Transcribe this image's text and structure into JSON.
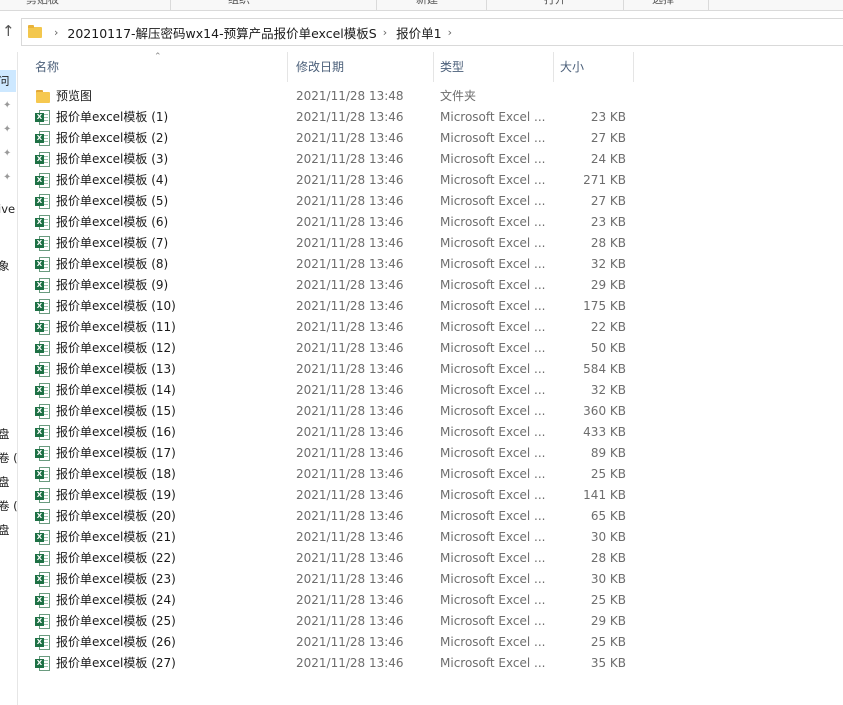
{
  "ribbon": {
    "groups": [
      "剪贴板",
      "组织",
      "新建",
      "打开",
      "选择"
    ]
  },
  "address": {
    "crumbs": [
      "20210117-解压密码wx14-预算产品报价单excel模板S",
      "报价单1"
    ]
  },
  "nav_pane": {
    "items": [
      "问",
      "ive",
      "象",
      "盘",
      "卷 (",
      "盘",
      "卷 (",
      "盘"
    ]
  },
  "columns": {
    "name": "名称",
    "date": "修改日期",
    "type": "类型",
    "size": "大小"
  },
  "files": [
    {
      "name": "预览图",
      "date": "2021/11/28 13:48",
      "type": "文件夹",
      "size": "",
      "icon": "folder-icon"
    },
    {
      "name": "报价单excel模板 (1)",
      "date": "2021/11/28 13:46",
      "type": "Microsoft Excel ...",
      "size": "23 KB",
      "icon": "excel-file-icon"
    },
    {
      "name": "报价单excel模板 (2)",
      "date": "2021/11/28 13:46",
      "type": "Microsoft Excel ...",
      "size": "27 KB",
      "icon": "excel-file-icon"
    },
    {
      "name": "报价单excel模板 (3)",
      "date": "2021/11/28 13:46",
      "type": "Microsoft Excel ...",
      "size": "24 KB",
      "icon": "excel-file-icon"
    },
    {
      "name": "报价单excel模板 (4)",
      "date": "2021/11/28 13:46",
      "type": "Microsoft Excel ...",
      "size": "271 KB",
      "icon": "excel-file-icon"
    },
    {
      "name": "报价单excel模板 (5)",
      "date": "2021/11/28 13:46",
      "type": "Microsoft Excel ...",
      "size": "27 KB",
      "icon": "excel-file-icon"
    },
    {
      "name": "报价单excel模板 (6)",
      "date": "2021/11/28 13:46",
      "type": "Microsoft Excel ...",
      "size": "23 KB",
      "icon": "excel-file-icon"
    },
    {
      "name": "报价单excel模板 (7)",
      "date": "2021/11/28 13:46",
      "type": "Microsoft Excel ...",
      "size": "28 KB",
      "icon": "excel-file-icon"
    },
    {
      "name": "报价单excel模板 (8)",
      "date": "2021/11/28 13:46",
      "type": "Microsoft Excel ...",
      "size": "32 KB",
      "icon": "excel-file-icon"
    },
    {
      "name": "报价单excel模板 (9)",
      "date": "2021/11/28 13:46",
      "type": "Microsoft Excel ...",
      "size": "29 KB",
      "icon": "excel-file-icon"
    },
    {
      "name": "报价单excel模板 (10)",
      "date": "2021/11/28 13:46",
      "type": "Microsoft Excel ...",
      "size": "175 KB",
      "icon": "excel-file-icon"
    },
    {
      "name": "报价单excel模板 (11)",
      "date": "2021/11/28 13:46",
      "type": "Microsoft Excel ...",
      "size": "22 KB",
      "icon": "excel-file-icon"
    },
    {
      "name": "报价单excel模板 (12)",
      "date": "2021/11/28 13:46",
      "type": "Microsoft Excel ...",
      "size": "50 KB",
      "icon": "excel-file-icon"
    },
    {
      "name": "报价单excel模板 (13)",
      "date": "2021/11/28 13:46",
      "type": "Microsoft Excel ...",
      "size": "584 KB",
      "icon": "excel-file-icon"
    },
    {
      "name": "报价单excel模板 (14)",
      "date": "2021/11/28 13:46",
      "type": "Microsoft Excel ...",
      "size": "32 KB",
      "icon": "excel-file-icon"
    },
    {
      "name": "报价单excel模板 (15)",
      "date": "2021/11/28 13:46",
      "type": "Microsoft Excel ...",
      "size": "360 KB",
      "icon": "excel-file-icon"
    },
    {
      "name": "报价单excel模板 (16)",
      "date": "2021/11/28 13:46",
      "type": "Microsoft Excel ...",
      "size": "433 KB",
      "icon": "excel-file-icon"
    },
    {
      "name": "报价单excel模板 (17)",
      "date": "2021/11/28 13:46",
      "type": "Microsoft Excel ...",
      "size": "89 KB",
      "icon": "excel-file-icon"
    },
    {
      "name": "报价单excel模板 (18)",
      "date": "2021/11/28 13:46",
      "type": "Microsoft Excel ...",
      "size": "25 KB",
      "icon": "excel-file-icon"
    },
    {
      "name": "报价单excel模板 (19)",
      "date": "2021/11/28 13:46",
      "type": "Microsoft Excel ...",
      "size": "141 KB",
      "icon": "excel-file-icon"
    },
    {
      "name": "报价单excel模板 (20)",
      "date": "2021/11/28 13:46",
      "type": "Microsoft Excel ...",
      "size": "65 KB",
      "icon": "excel-file-icon"
    },
    {
      "name": "报价单excel模板 (21)",
      "date": "2021/11/28 13:46",
      "type": "Microsoft Excel ...",
      "size": "30 KB",
      "icon": "excel-file-icon"
    },
    {
      "name": "报价单excel模板 (22)",
      "date": "2021/11/28 13:46",
      "type": "Microsoft Excel ...",
      "size": "28 KB",
      "icon": "excel-file-icon"
    },
    {
      "name": "报价单excel模板 (23)",
      "date": "2021/11/28 13:46",
      "type": "Microsoft Excel ...",
      "size": "30 KB",
      "icon": "excel-file-icon"
    },
    {
      "name": "报价单excel模板 (24)",
      "date": "2021/11/28 13:46",
      "type": "Microsoft Excel ...",
      "size": "25 KB",
      "icon": "excel-file-icon"
    },
    {
      "name": "报价单excel模板 (25)",
      "date": "2021/11/28 13:46",
      "type": "Microsoft Excel ...",
      "size": "29 KB",
      "icon": "excel-file-icon"
    },
    {
      "name": "报价单excel模板 (26)",
      "date": "2021/11/28 13:46",
      "type": "Microsoft Excel ...",
      "size": "25 KB",
      "icon": "excel-file-icon"
    },
    {
      "name": "报价单excel模板 (27)",
      "date": "2021/11/28 13:46",
      "type": "Microsoft Excel ...",
      "size": "35 KB",
      "icon": "excel-file-icon"
    }
  ]
}
